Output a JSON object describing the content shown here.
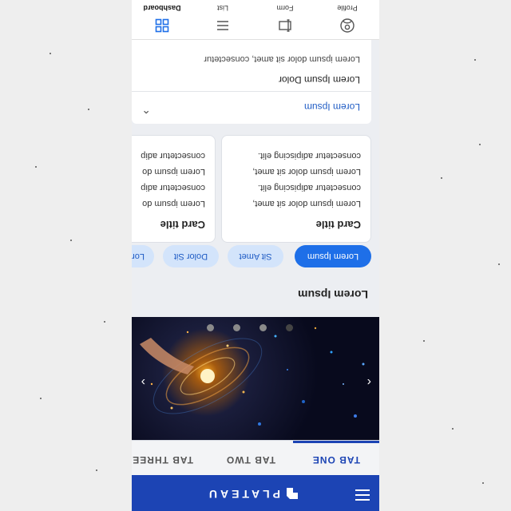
{
  "app": {
    "brand": "PLATEAU"
  },
  "tabs": [
    {
      "label": "TAB ONE"
    },
    {
      "label": "TAB TWO"
    },
    {
      "label": "TAB THREE"
    }
  ],
  "section": {
    "title": "Lorem Ipsum"
  },
  "chips": [
    {
      "label": "Lorem Ipsum"
    },
    {
      "label": "Sit Amet"
    },
    {
      "label": "Dolor Sit"
    },
    {
      "label": "Lor"
    }
  ],
  "cards": [
    {
      "title": "Card title",
      "lines": [
        "Lorem ipsum dolor sit amet,",
        "consectetur adipiscing elit.",
        "Lorem ipsum dolor sit amet,",
        "consectetur adipiscing elit."
      ]
    },
    {
      "title": "Card title",
      "lines": [
        "Lorem ipsum do",
        "consectetur adip",
        "Lorem ipsum do",
        "consectetur adip"
      ]
    }
  ],
  "panel": {
    "title": "Lorem Ipsum",
    "item_title": "Lorem Ipsum Dolor",
    "item_subtitle": "Lorem ipsum dolor sit amet, consectetur"
  },
  "bottom_nav": [
    {
      "label": "Dashboard",
      "icon": "dashboard-icon"
    },
    {
      "label": "List",
      "icon": "list-icon"
    },
    {
      "label": "Form",
      "icon": "form-icon"
    },
    {
      "label": "Profile",
      "icon": "profile-icon"
    }
  ],
  "colors": {
    "primary": "#1c44b4",
    "chip_selected": "#1e6fe8",
    "chip_plain": "#d3e4fb"
  }
}
